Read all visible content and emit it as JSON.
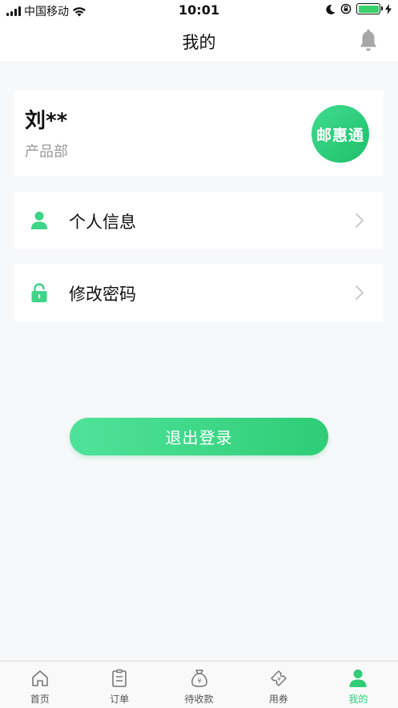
{
  "status_bar": {
    "carrier": "中国移动",
    "time": "10:01"
  },
  "nav": {
    "title": "我的"
  },
  "profile": {
    "name": "刘**",
    "department": "产品部",
    "logo_text": "邮惠通"
  },
  "menu": {
    "items": [
      {
        "label": "个人信息",
        "icon": "person-icon"
      },
      {
        "label": "修改密码",
        "icon": "lock-icon"
      }
    ]
  },
  "logout": {
    "label": "退出登录"
  },
  "tabs": [
    {
      "label": "首页",
      "icon": "home-icon"
    },
    {
      "label": "订单",
      "icon": "clipboard-icon"
    },
    {
      "label": "待收款",
      "icon": "money-bag-icon"
    },
    {
      "label": "用券",
      "icon": "coupon-icon"
    },
    {
      "label": "我的",
      "icon": "person-icon",
      "active": true
    }
  ],
  "colors": {
    "accent": "#2fcd77",
    "background": "#f7f8fa"
  }
}
